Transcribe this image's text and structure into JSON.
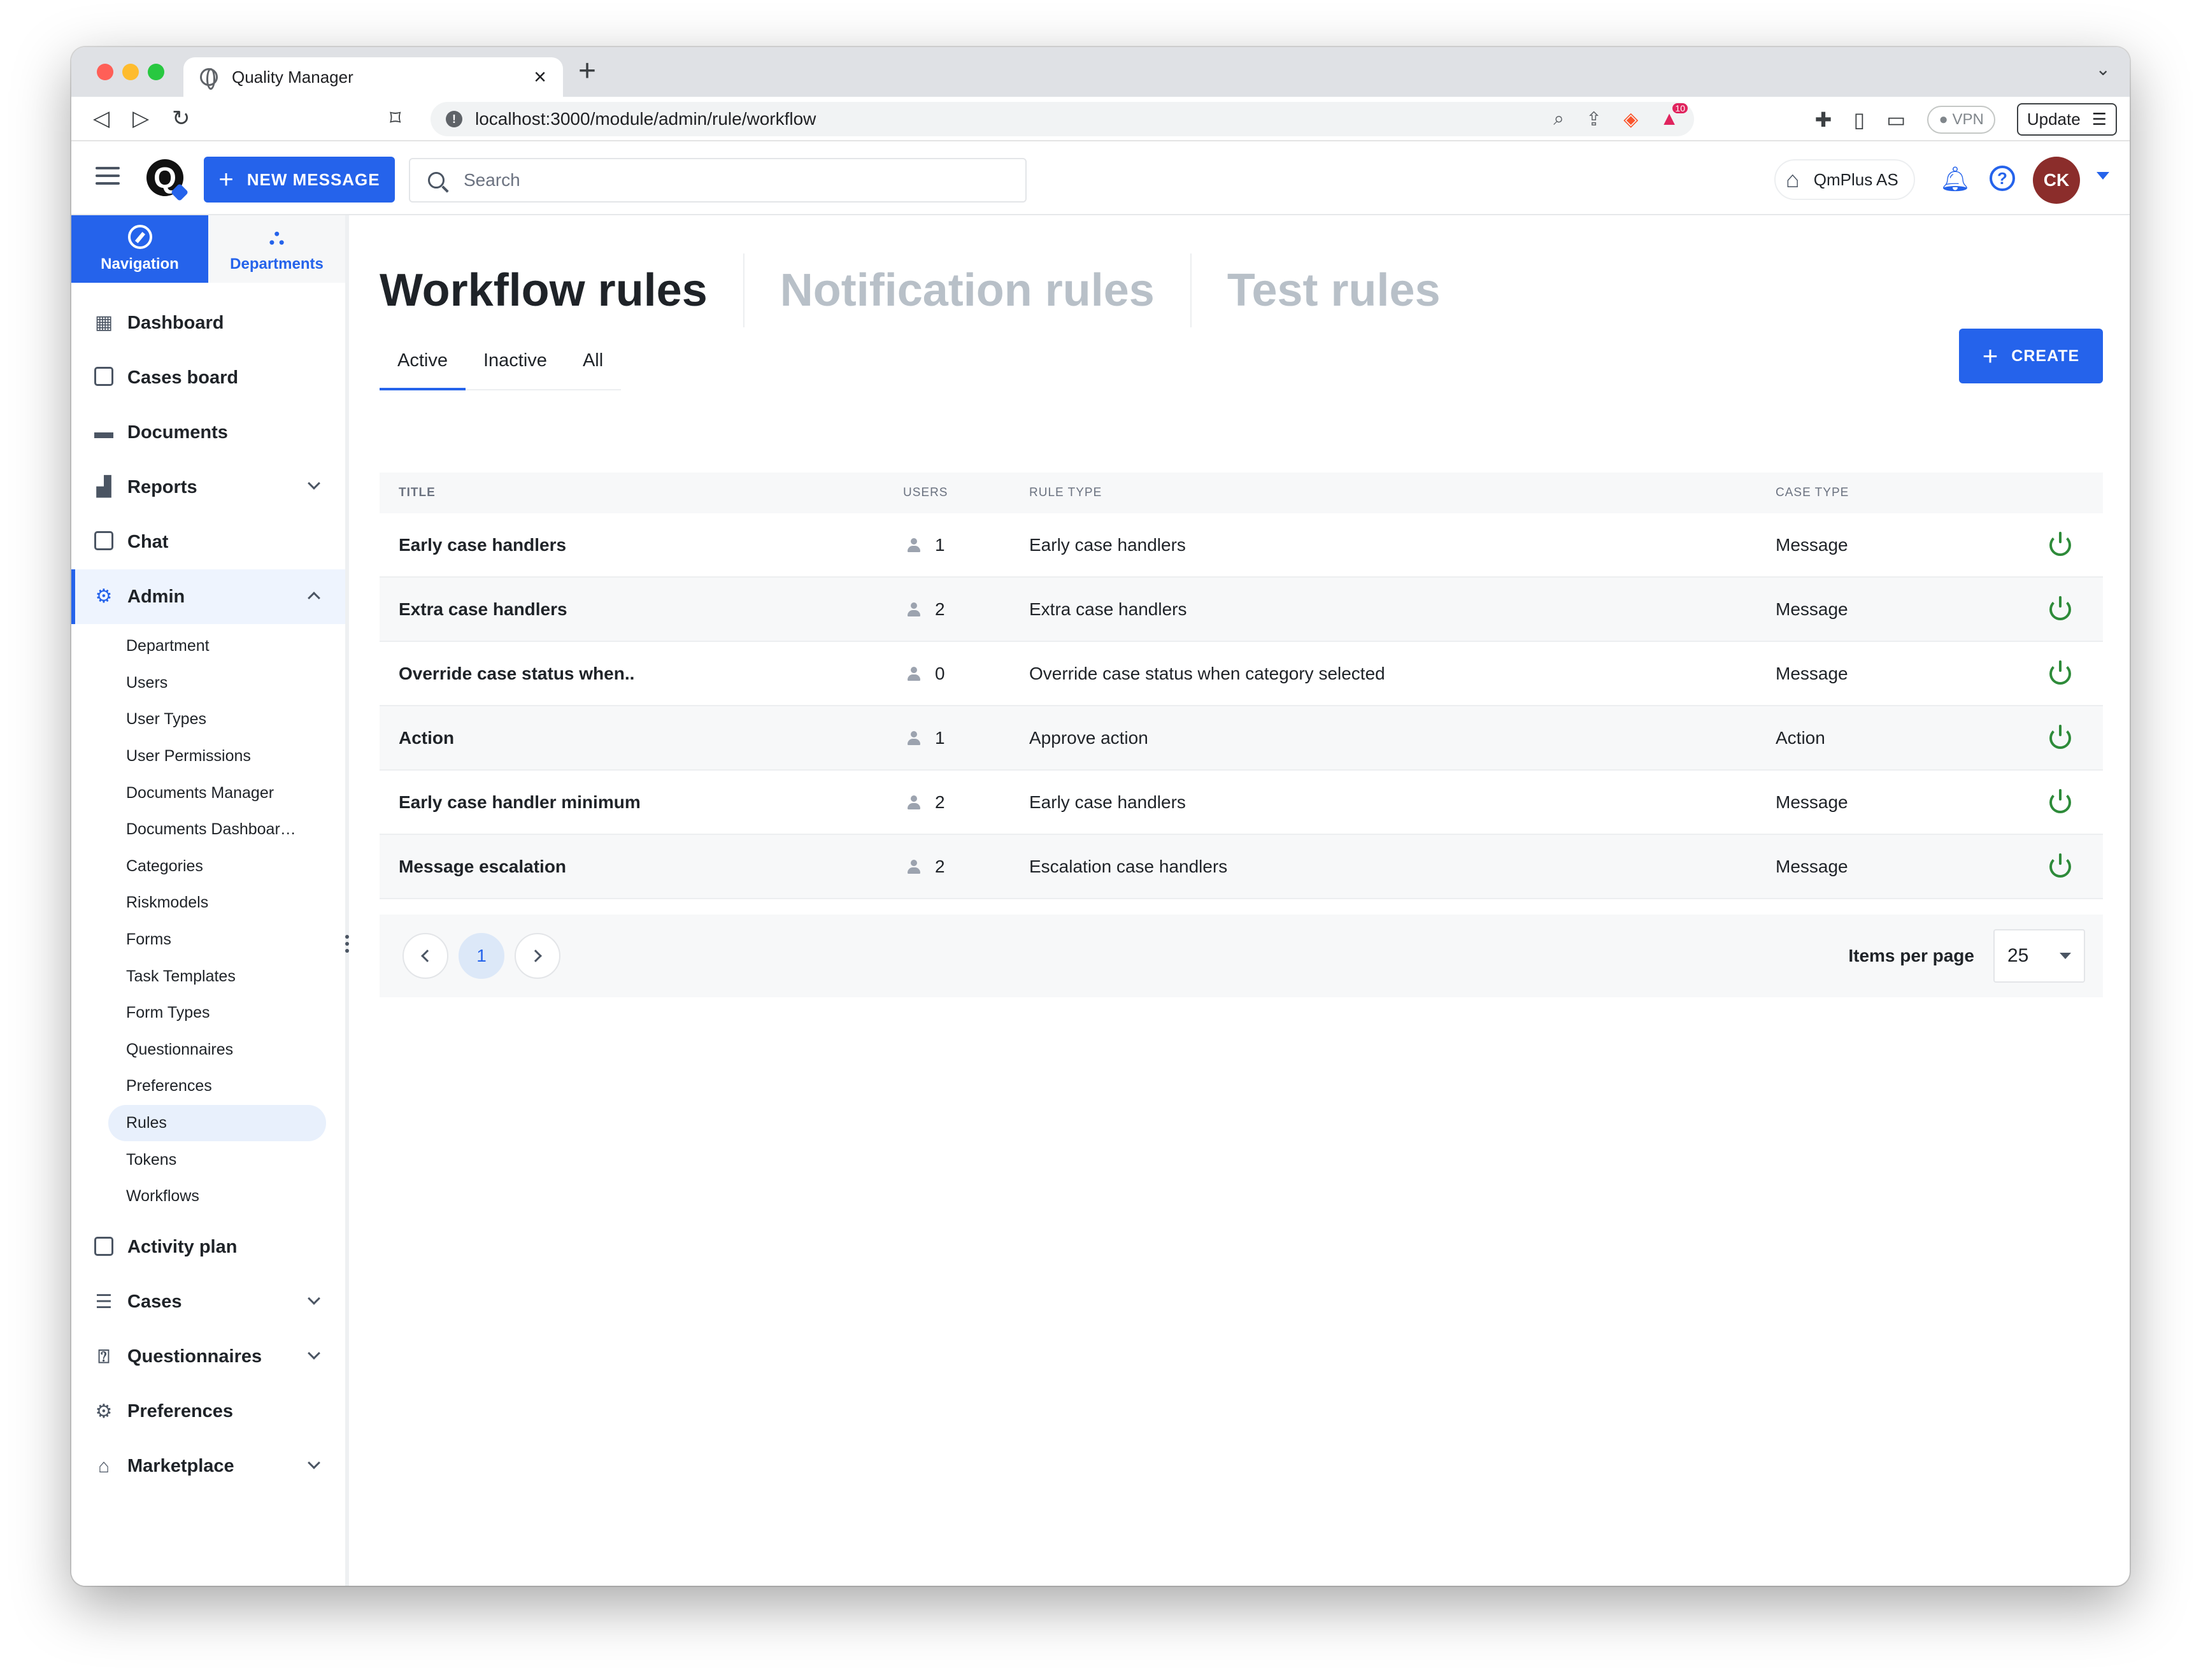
{
  "browser": {
    "tab_title": "Quality Manager",
    "url": "localhost:3000/module/admin/rule/workflow",
    "vpn_label": "VPN",
    "update_label": "Update",
    "badge_count": "10"
  },
  "header": {
    "new_message_label": "NEW MESSAGE",
    "search_placeholder": "Search",
    "company": "QmPlus AS",
    "avatar_initials": "CK",
    "logo_letter": "Q"
  },
  "sidebar": {
    "tabs": [
      {
        "label": "Navigation"
      },
      {
        "label": "Departments"
      }
    ],
    "items": [
      {
        "label": "Dashboard"
      },
      {
        "label": "Cases board"
      },
      {
        "label": "Documents"
      },
      {
        "label": "Reports"
      },
      {
        "label": "Chat"
      },
      {
        "label": "Admin"
      },
      {
        "label": "Activity plan"
      },
      {
        "label": "Cases"
      },
      {
        "label": "Questionnaires"
      },
      {
        "label": "Preferences"
      },
      {
        "label": "Marketplace"
      }
    ],
    "admin_sub": [
      "Department",
      "Users",
      "User Types",
      "User Permissions",
      "Documents Manager",
      "Documents Dashboar…",
      "Categories",
      "Riskmodels",
      "Forms",
      "Task Templates",
      "Form Types",
      "Questionnaires",
      "Preferences",
      "Rules",
      "Tokens",
      "Workflows"
    ]
  },
  "main": {
    "headings": [
      "Workflow rules",
      "Notification rules",
      "Test rules"
    ],
    "subtabs": [
      "Active",
      "Inactive",
      "All"
    ],
    "create_label": "CREATE",
    "columns": [
      "TITLE",
      "USERS",
      "RULE TYPE",
      "CASE TYPE"
    ],
    "rows": [
      {
        "title": "Early case handlers",
        "users": "1",
        "rule_type": "Early case handlers",
        "case_type": "Message"
      },
      {
        "title": "Extra case handlers",
        "users": "2",
        "rule_type": "Extra case handlers",
        "case_type": "Message"
      },
      {
        "title": "Override case status when..",
        "users": "0",
        "rule_type": "Override case status when category selected",
        "case_type": "Message"
      },
      {
        "title": "Action",
        "users": "1",
        "rule_type": "Approve action",
        "case_type": "Action"
      },
      {
        "title": "Early case handler minimum",
        "users": "2",
        "rule_type": "Early case handlers",
        "case_type": "Message"
      },
      {
        "title": "Message escalation",
        "users": "2",
        "rule_type": "Escalation case handlers",
        "case_type": "Message"
      }
    ],
    "pager": {
      "current_page": "1",
      "items_per_page_label": "Items per page",
      "items_per_page": "25"
    }
  }
}
